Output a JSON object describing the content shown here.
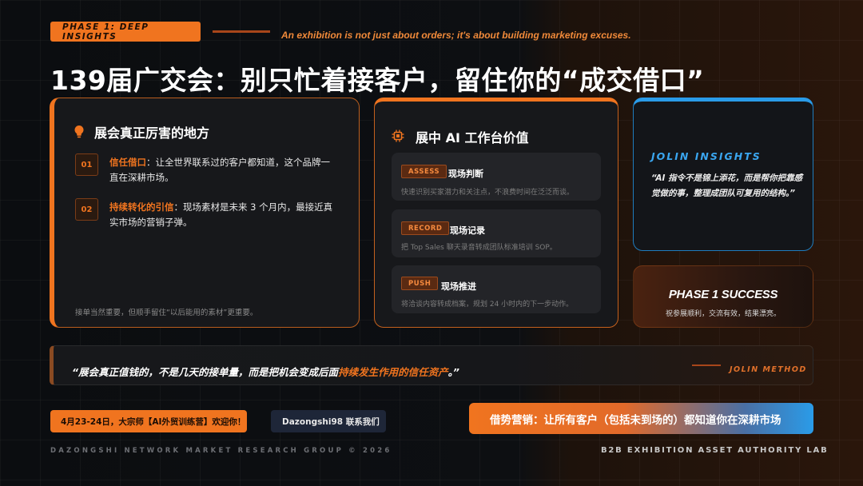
{
  "header": {
    "phase_tag": "PHASE 1: DEEP INSIGHTS",
    "tagline": "An exhibition is not just about orders; it's about building marketing excuses.",
    "title": "139届广交会：别只忙着接客户，留住你的“成交借口”"
  },
  "card_strengths": {
    "title": "展会真正厉害的地方",
    "icon": "lightbulb-icon",
    "points": [
      {
        "num": "01",
        "highlight": "信任借口",
        "text": "：让全世界联系过的客户都知道，这个品牌一直在深耕市场。"
      },
      {
        "num": "02",
        "highlight": "持续转化的引信",
        "text": "：现场素材是未来 3 个月内，最接近真实市场的营销子弹。"
      }
    ],
    "footnote": "接单当然重要，但顺手留住“以后能用的素材”更重要。"
  },
  "card_ai": {
    "title": "展中 AI 工作台价值",
    "icon": "chip-icon",
    "steps": [
      {
        "badge": "ASSESS",
        "title": "现场判断",
        "desc": "快速识别买家潜力和关注点，不浪费时间在泛泛而谈。"
      },
      {
        "badge": "RECORD",
        "title": "现场记录",
        "desc": "把 Top Sales 聊天录音转成团队标准培训 SOP。"
      },
      {
        "badge": "PUSH",
        "title": "现场推进",
        "desc": "将洽谈内容转成档案，规划 24 小时内的下一步动作。"
      }
    ]
  },
  "insights": {
    "label": "JOLIN INSIGHTS",
    "quote": "“AI 指令不是锦上添花，而是帮你把靠感觉做的事，整理成团队可复用的结构。”"
  },
  "success": {
    "title": "PHASE 1 SUCCESS",
    "subtitle": "祝参展顺利，交流有效，结果漂亮。"
  },
  "quote_bar": {
    "text_before": "“展会真正值钱的，不是几天的接单量，而是把机会变成后面",
    "highlight": "持续发生作用的信任资产",
    "text_after": "。”",
    "method_label": "JOLIN METHOD"
  },
  "bottom": {
    "promo": "4月23-24日，大宗师【AI外贸训练营】欢迎你！",
    "contact": "Dazongshi98 联系我们",
    "slogan": "借势营销：让所有客户（包括未到场的）都知道你在深耕市场",
    "footer_left": "DAZONGSHI NETWORK MARKET RESEARCH GROUP © 2026",
    "footer_right": "B2B EXHIBITION ASSET AUTHORITY LAB"
  },
  "colors": {
    "accent_orange": "#f0741f",
    "accent_blue": "#2a9be8",
    "background": "#0d0f12"
  }
}
